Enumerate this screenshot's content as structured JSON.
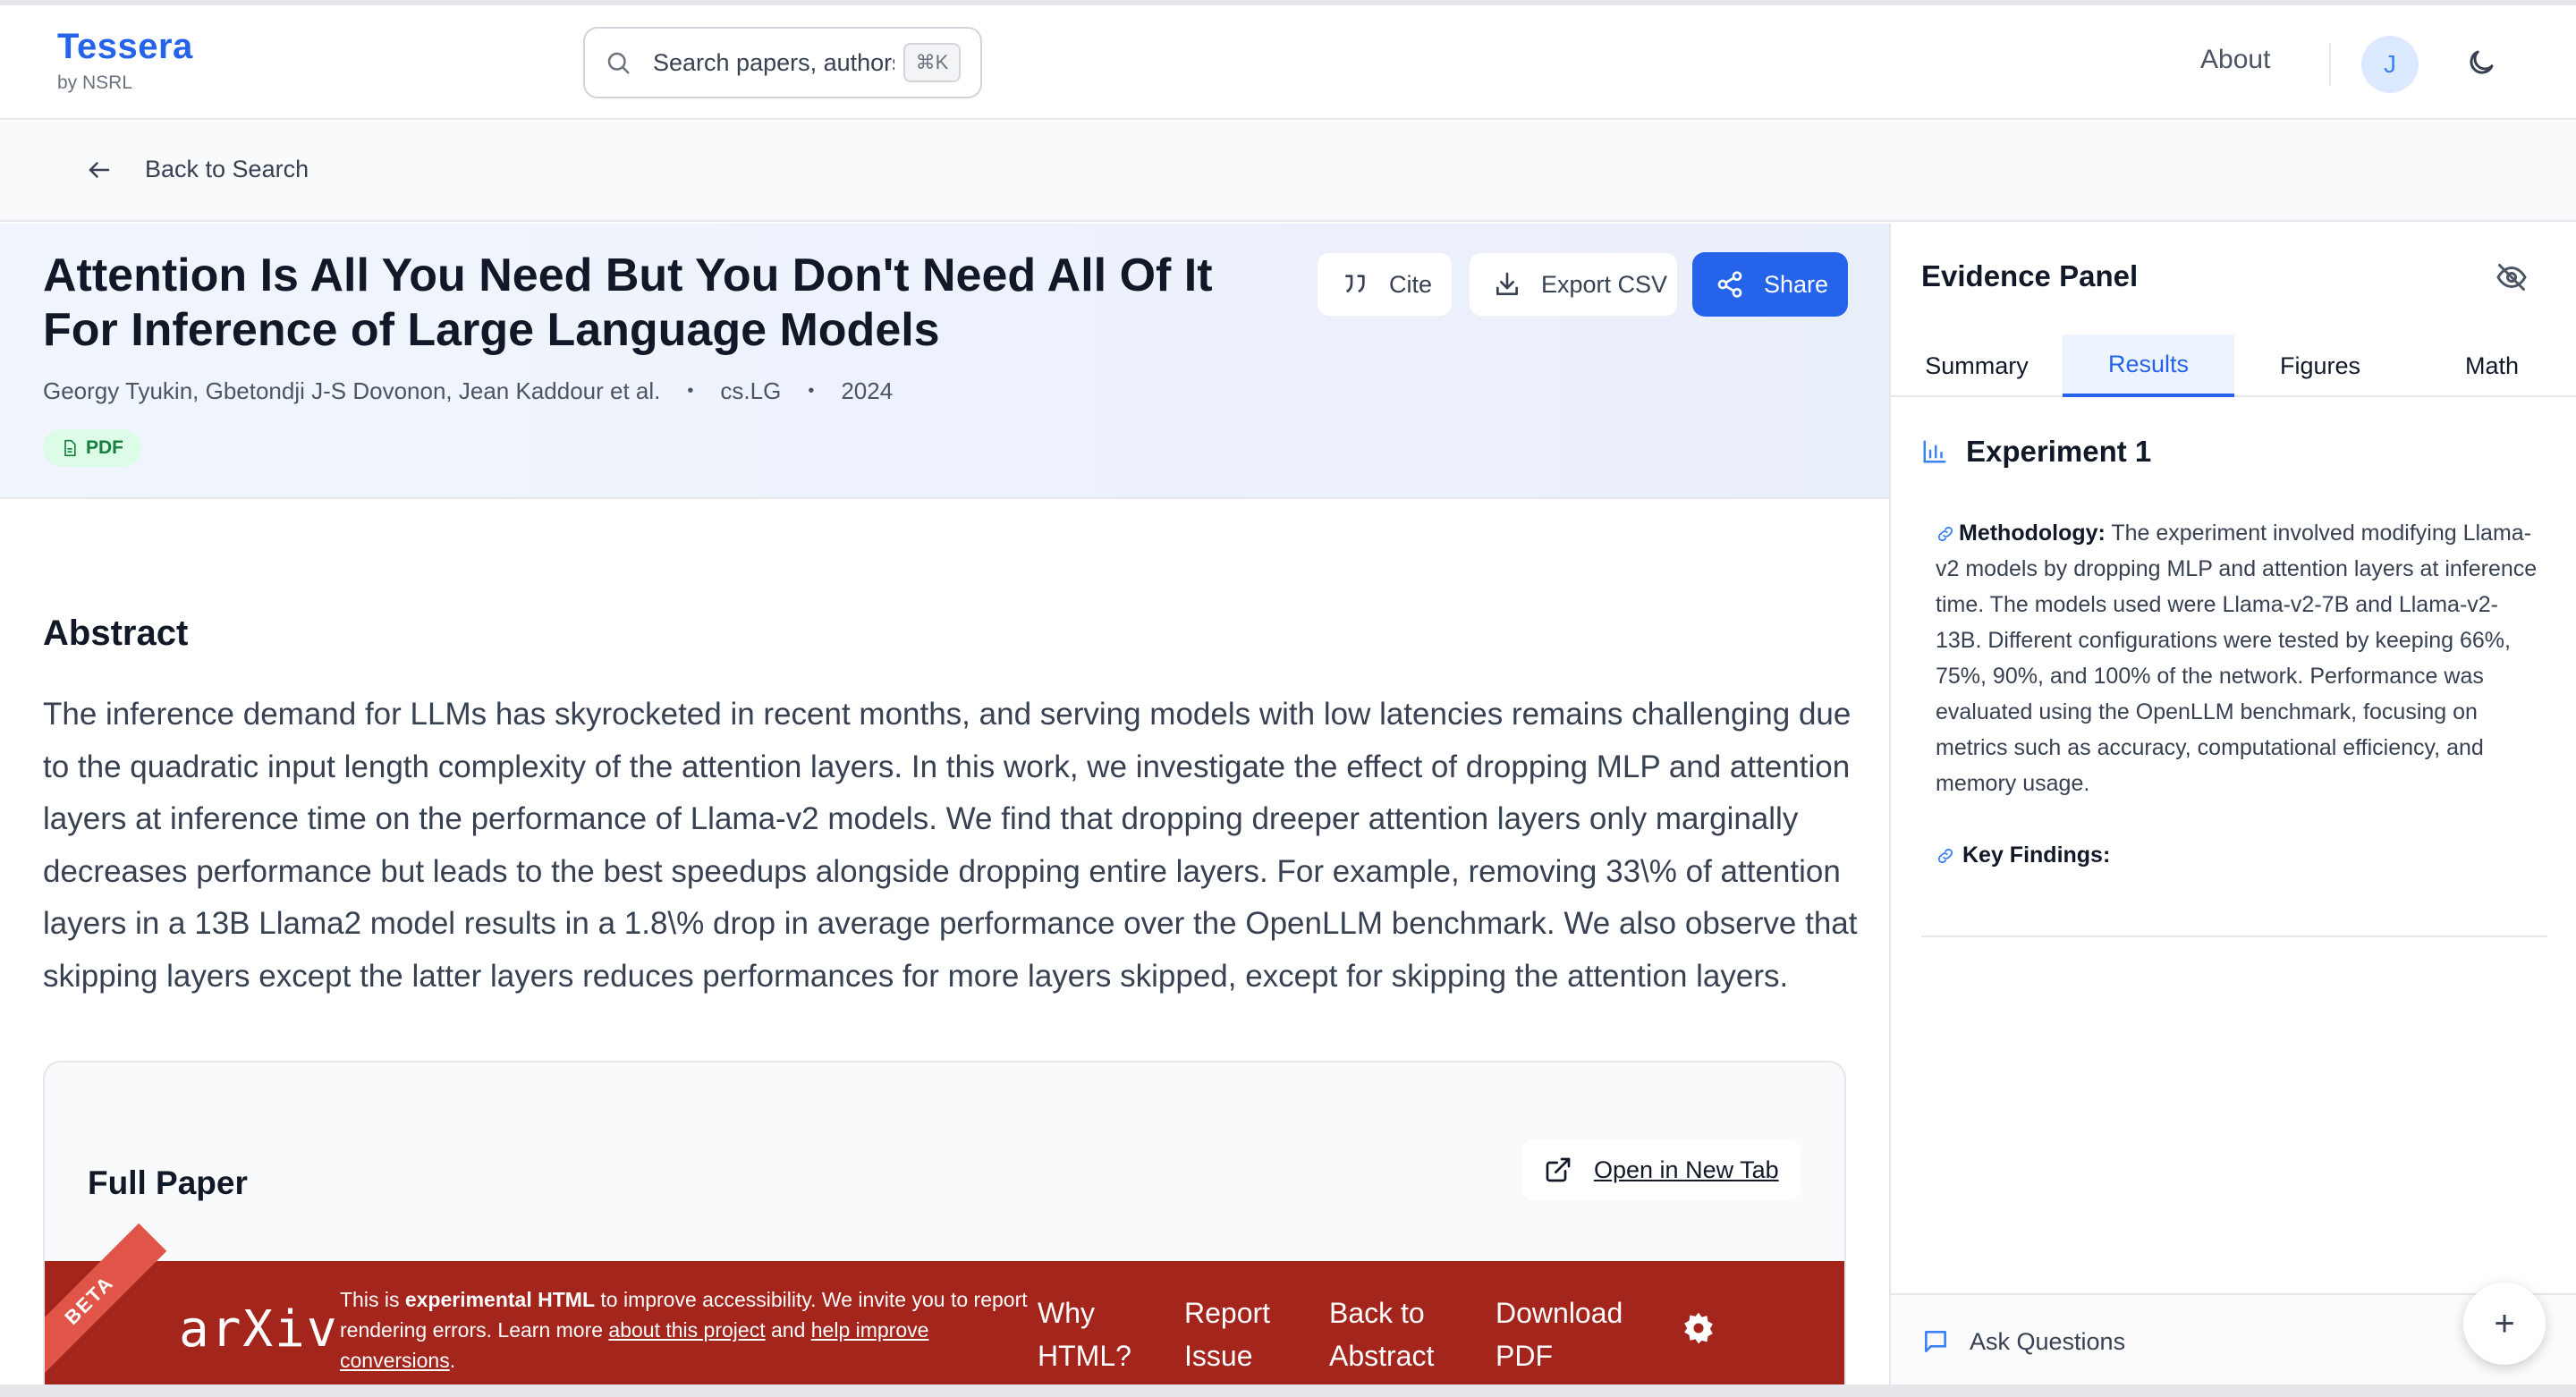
{
  "navbar": {
    "brand": "Tessera",
    "brand_sub": "by NSRL",
    "search_placeholder": "Search papers, authors",
    "search_shortcut": "⌘K",
    "about": "About",
    "avatar_initial": "J"
  },
  "back": {
    "label": "Back to Search"
  },
  "paper": {
    "title": "Attention Is All You Need But You Don't Need All Of It For Inference of Large Language Models",
    "authors": "Georgy Tyukin, Gbetondji J-S Dovonon, Jean Kaddour et al.",
    "category": "cs.LG",
    "year": "2024",
    "badge": "PDF",
    "actions": {
      "cite": "Cite",
      "export": "Export CSV",
      "share": "Share"
    }
  },
  "abstract": {
    "heading": "Abstract",
    "text": "The inference demand for LLMs has skyrocketed in recent months, and serving models with low latencies remains challenging due to the quadratic input length complexity of the attention layers. In this work, we investigate the effect of dropping MLP and attention layers at inference time on the performance of Llama-v2 models. We find that dropping dreeper attention layers only marginally decreases performance but leads to the best speedups alongside dropping entire layers. For example, removing 33\\% of attention layers in a 13B Llama2 model results in a 1.8\\% drop in average performance over the OpenLLM benchmark. We also observe that skipping layers except the latter layers reduces performances for more layers skipped, except for skipping the attention layers."
  },
  "full_paper": {
    "heading": "Full Paper",
    "open_new_tab": "Open in New Tab",
    "arxiv": {
      "beta": "BETA",
      "logo": "arXiv",
      "msg_prefix": "This is ",
      "msg_bold": "experimental HTML",
      "msg_mid": " to improve accessibility. We invite you to report rendering errors. Learn more ",
      "link_project": "about this project",
      "msg_and": " and ",
      "link_help": "help improve conversions",
      "msg_end": ".",
      "links": [
        "Why HTML?",
        "Report Issue",
        "Back to Abstract",
        "Download PDF"
      ]
    }
  },
  "evidence": {
    "title": "Evidence Panel",
    "tabs": [
      "Summary",
      "Results",
      "Figures",
      "Math"
    ],
    "active_tab": "Results",
    "experiment_heading": "Experiment 1",
    "methodology_label": "Methodology:",
    "methodology_text": " The experiment involved modifying Llama-v2 models by dropping MLP and attention layers at inference time. The models used were Llama-v2-7B and Llama-v2-13B. Different configurations were tested by keeping 66%, 75%, 90%, and 100% of the network. Performance was evaluated using the OpenLLM benchmark, focusing on metrics such as accuracy, computational efficiency, and memory usage.",
    "findings_label": "Key Findings:",
    "ask": "Ask Questions",
    "fab": "+"
  },
  "colors": {
    "brand": "#2563eb",
    "share_button": "#2563eb",
    "arxiv_bar": "#a4251c",
    "pdf_badge": "#dcfce7"
  }
}
